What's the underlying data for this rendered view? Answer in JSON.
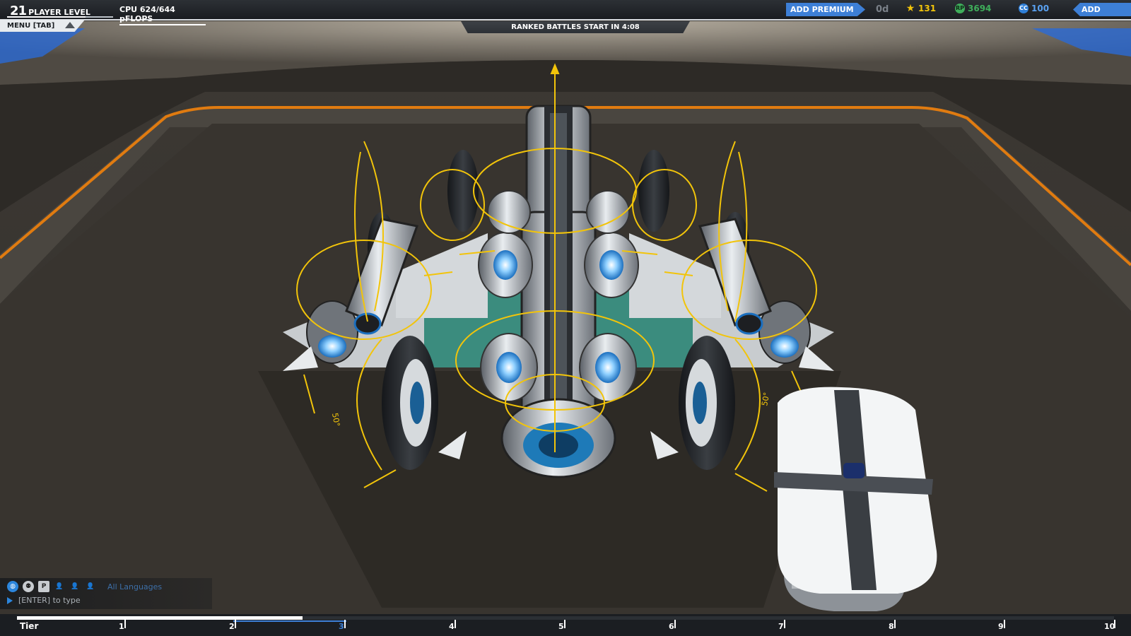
{
  "hud": {
    "player_level_number": "21",
    "player_level_label": "PLAYER LEVEL",
    "level_progress": 0.74,
    "cpu_text": "CPU 624/644 pFLOPS",
    "add_premium_label": "ADD PREMIUM",
    "premium_days": "0d",
    "currency_stars": "131",
    "currency_rp": "3694",
    "currency_cc": "100",
    "add_funds_label": "ADD FUNDS",
    "menu_label": "MENU [TAB]",
    "ranked_notice": "RANKED BATTLES START IN 4:08"
  },
  "chat": {
    "language_filter": "All Languages",
    "input_hint": "[ENTER] to type"
  },
  "tier": {
    "label": "Tier",
    "marks": [
      "1",
      "2",
      "3",
      "4",
      "5",
      "6",
      "7",
      "8",
      "9",
      "10"
    ],
    "active_mark": "3",
    "progress": 0.26
  },
  "robot_overlay_labels": {
    "left_angle": "50°",
    "right_angle": "50°"
  },
  "colors": {
    "accent_blue": "#3d7fd6",
    "gizmo_yellow": "#f2c40a",
    "platform_edge_orange": "#e07b10"
  }
}
